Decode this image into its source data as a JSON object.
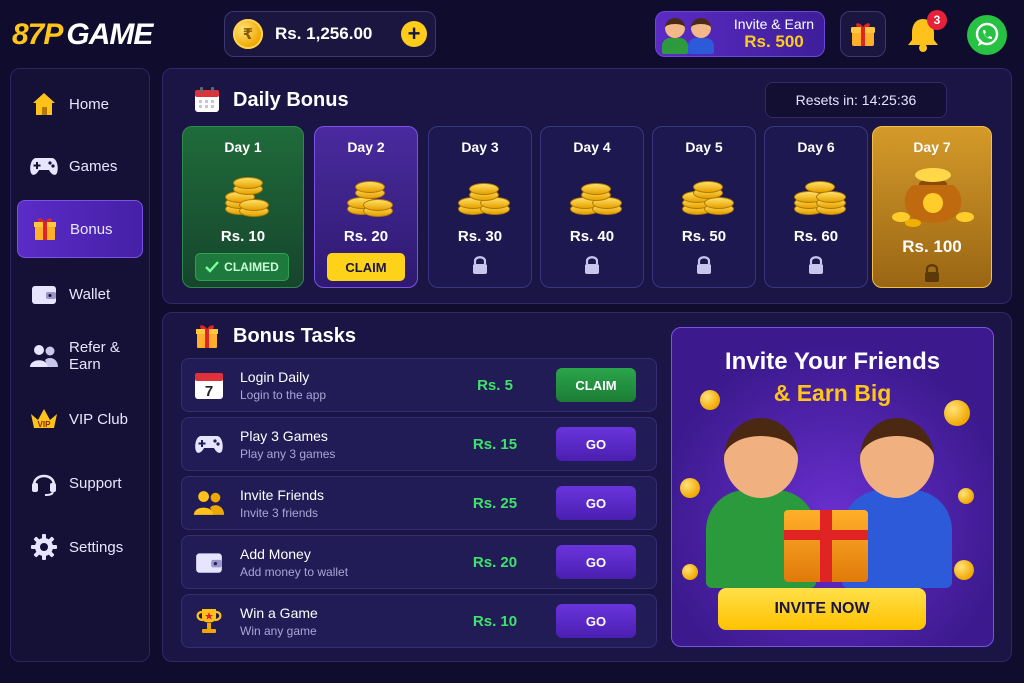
{
  "header": {
    "logo_num": "87P",
    "logo_word": "GAME",
    "balance": "Rs. 1,256.00",
    "invite_label": "Invite & Earn",
    "invite_amount": "Rs. 500",
    "notification_count": "3"
  },
  "sidebar": {
    "items": [
      {
        "label": "Home",
        "icon": "home-icon"
      },
      {
        "label": "Games",
        "icon": "gamepad-icon"
      },
      {
        "label": "Bonus",
        "icon": "gift-icon",
        "active": true
      },
      {
        "label": "Wallet",
        "icon": "wallet-icon"
      },
      {
        "label": "Refer & Earn",
        "icon": "users-icon"
      },
      {
        "label": "VIP Club",
        "icon": "crown-icon"
      },
      {
        "label": "Support",
        "icon": "headset-icon"
      },
      {
        "label": "Settings",
        "icon": "gear-icon"
      }
    ]
  },
  "daily_bonus": {
    "title": "Daily Bonus",
    "resets": "Resets in: 14:25:36",
    "days": [
      {
        "label": "Day 1",
        "reward": "Rs. 10",
        "status": "CLAIMED"
      },
      {
        "label": "Day 2",
        "reward": "Rs. 20",
        "status": "CLAIM"
      },
      {
        "label": "Day 3",
        "reward": "Rs. 30",
        "status": "locked"
      },
      {
        "label": "Day 4",
        "reward": "Rs. 40",
        "status": "locked"
      },
      {
        "label": "Day 5",
        "reward": "Rs. 50",
        "status": "locked"
      },
      {
        "label": "Day 6",
        "reward": "Rs. 60",
        "status": "locked"
      },
      {
        "label": "Day 7",
        "reward": "Rs. 100",
        "status": "locked"
      }
    ]
  },
  "tasks": {
    "title": "Bonus Tasks",
    "items": [
      {
        "name": "Login Daily",
        "sub": "Login to the app",
        "reward": "Rs. 5",
        "button": "CLAIM",
        "icon": "calendar-icon",
        "icon_text": "7"
      },
      {
        "name": "Play 3 Games",
        "sub": "Play any 3 games",
        "reward": "Rs. 15",
        "button": "GO",
        "icon": "gamepad-icon"
      },
      {
        "name": "Invite Friends",
        "sub": "Invite 3 friends",
        "reward": "Rs. 25",
        "button": "GO",
        "icon": "users-icon"
      },
      {
        "name": "Add Money",
        "sub": "Add money to wallet",
        "reward": "Rs. 20",
        "button": "GO",
        "icon": "wallet-icon"
      },
      {
        "name": "Win a Game",
        "sub": "Win any game",
        "reward": "Rs. 10",
        "button": "GO",
        "icon": "trophy-icon"
      }
    ]
  },
  "invite_card": {
    "title_line1": "Invite Your Friends",
    "title_line2": "& Earn Big",
    "button": "INVITE NOW"
  },
  "colors": {
    "accent_purple": "#5a2cc7",
    "gold": "#ffc61a",
    "green": "#3ee36a",
    "background": "#0f0c2e"
  }
}
